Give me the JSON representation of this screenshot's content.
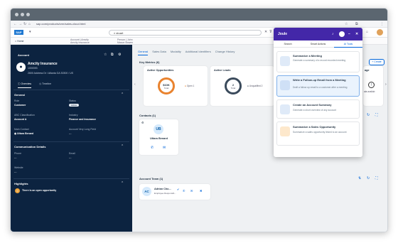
{
  "browser": {
    "url": "sap.com/products/crm/sales-cloud.html"
  },
  "shell": {
    "home": "Home",
    "tab1_a": "Account | Amcity",
    "tab1_b": "Amcity Insurance",
    "tab2_a": "Person | John",
    "tab2_b": "Mason Bowen",
    "search_value": "stuart"
  },
  "account": {
    "header": "Account",
    "name": "Amcity Insurance",
    "id": "1000393",
    "address": "2600 Address Dr / Atlanta GA 30300 / US",
    "tab_overview": "Overview",
    "tab_timeline": "Timeline"
  },
  "general": {
    "title": "General",
    "role_l": "Role",
    "role_v": "Customer",
    "status_l": "Status",
    "status_v": "Active",
    "abc_l": "ABC Classification",
    "abc_v": "Account A",
    "industry_l": "Industry",
    "industry_v": "Finance and Insurance",
    "contact_l": "Main Contact",
    "contact_v": "Uttara Benard",
    "owner_l": "Account Very Long Field",
    "owner_v": "---"
  },
  "comm": {
    "title": "Communication Details",
    "phone_l": "Phone",
    "phone_v": "---",
    "email_l": "Email",
    "email_v": "---",
    "web_l": "Website",
    "web_v": "---"
  },
  "highlights": {
    "title": "Highlights",
    "item": "There is an open opportunity"
  },
  "main": {
    "tabs": [
      "General",
      "Sales Data",
      "Modality",
      "Additional Identifiers",
      "Change History"
    ],
    "key_title": "Key Metrics (6)",
    "opp_title": "Active Opportunities",
    "opp_value": "$10K",
    "opp_sub": "Total",
    "opp_legend": "Open 1",
    "leads_title": "Active Leads",
    "leads_value": "2",
    "leads_sub": "Total",
    "leads_legend": "Unqualified 2",
    "right_partial": "age",
    "right_partial2": "ata availab",
    "contacts_title": "Contacts (1)",
    "contact_initials": "UB",
    "contact_name": "Uttara Benard",
    "team_title": "Account Team (1)",
    "team_initials": "AC",
    "team_name": "Adrian Cho...",
    "team_role": "Employee Responsib...",
    "create": "Create"
  },
  "joule": {
    "title": "Joule",
    "tabs": [
      "Search",
      "Smart Actions",
      "AI Tools"
    ],
    "cards": [
      {
        "title": "Summarize a Meeting",
        "desc": "Generate a summary of a record recorded meeting"
      },
      {
        "title": "Write a Follow-up Email from a Meeting",
        "desc": "Draft a follow up email to a customer after a meeting"
      },
      {
        "title": "Create an Account Summary",
        "desc": "Generate a short overview of any account"
      },
      {
        "title": "Summarize a Sales Opportunity",
        "desc": "Summarize a sales opportunity linked to an account"
      }
    ]
  },
  "colors": {
    "sidebar": "#0c2340",
    "joule": "#4327a8",
    "accent": "#0064d9"
  }
}
